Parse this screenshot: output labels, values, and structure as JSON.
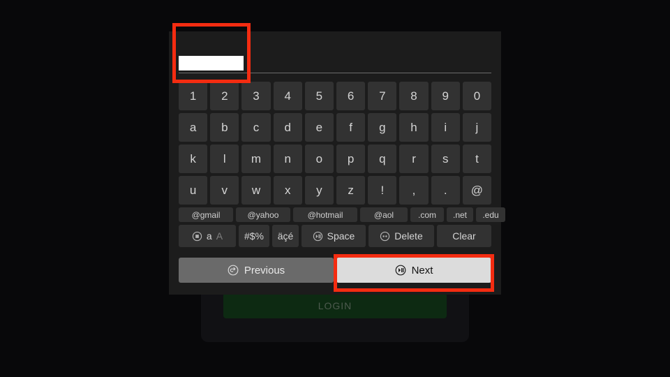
{
  "background_color": "#08080a",
  "panel": {
    "background_color": "#1c1c1c",
    "input": {
      "value": "",
      "placeholder": "",
      "field_color": "#ffffff"
    },
    "rows": [
      {
        "name": "digits",
        "keys": [
          "1",
          "2",
          "3",
          "4",
          "5",
          "6",
          "7",
          "8",
          "9",
          "0"
        ]
      },
      {
        "name": "letters-a-j",
        "keys": [
          "a",
          "b",
          "c",
          "d",
          "e",
          "f",
          "g",
          "h",
          "i",
          "j"
        ]
      },
      {
        "name": "letters-k-t",
        "keys": [
          "k",
          "l",
          "m",
          "n",
          "o",
          "p",
          "q",
          "r",
          "s",
          "t"
        ]
      },
      {
        "name": "letters-u-z-punct",
        "keys": [
          "u",
          "v",
          "w",
          "x",
          "y",
          "z",
          "!",
          ",",
          ".",
          "@"
        ]
      }
    ],
    "domain_row": [
      {
        "label": "@gmail",
        "width_class": "w-gmail"
      },
      {
        "label": "@yahoo",
        "width_class": "w-yahoo"
      },
      {
        "label": "@hotmail",
        "width_class": "w-hotmail"
      },
      {
        "label": "@aol",
        "width_class": "w-aol"
      },
      {
        "label": ".com",
        "width_class": "w-com"
      },
      {
        "label": ".net",
        "width_class": "w-net"
      },
      {
        "label": ".edu",
        "width_class": "w-edu"
      }
    ],
    "function_row": {
      "case_lower": "a",
      "case_upper": "A",
      "symbols": "#$%",
      "accents": "äçé",
      "space": "Space",
      "delete": "Delete",
      "clear": "Clear"
    },
    "nav": {
      "previous": "Previous",
      "next": "Next",
      "previous_color": "#6a6a6a",
      "next_color": "#dcdcdc"
    }
  },
  "underlying_page": {
    "login_button": "LOGIN",
    "login_button_color": "#0d2a12"
  },
  "highlights": {
    "color": "#f42c11",
    "items": [
      {
        "name": "input-field-highlight"
      },
      {
        "name": "next-button-highlight"
      }
    ]
  }
}
